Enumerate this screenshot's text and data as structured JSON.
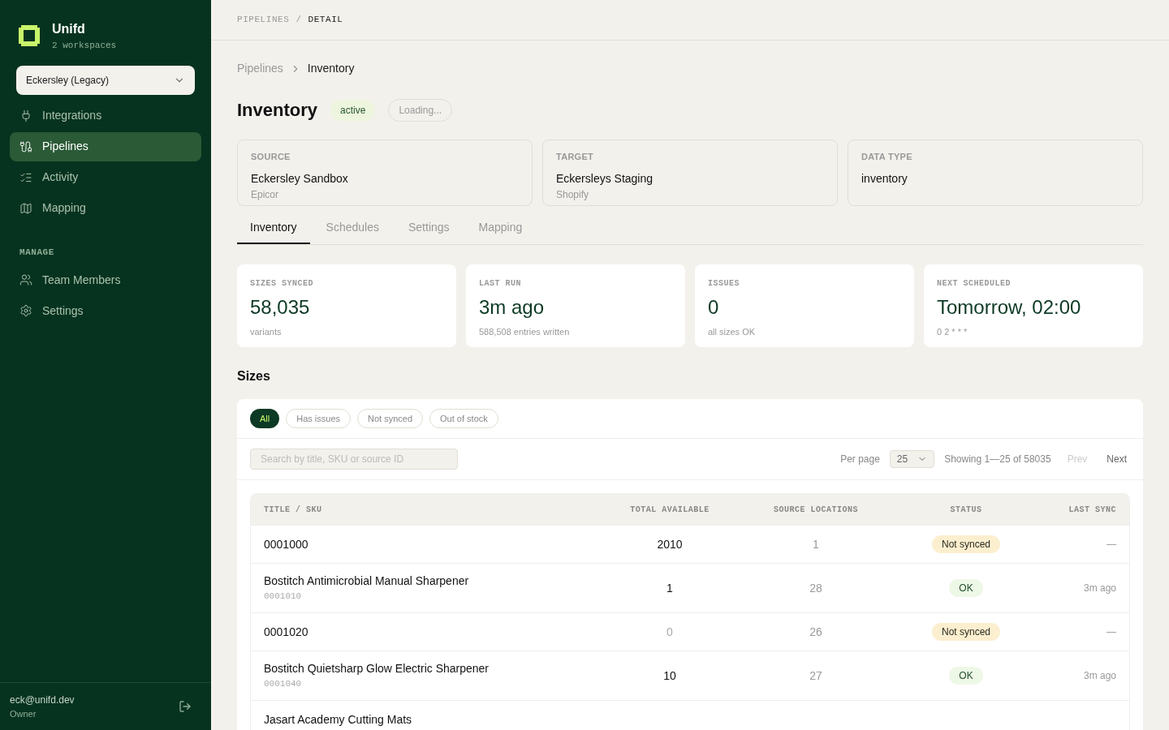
{
  "brand": {
    "name": "Unifd",
    "subtitle": "2 workspaces"
  },
  "workspace": {
    "value": "Eckersley (Legacy)"
  },
  "nav": [
    {
      "label": "Integrations",
      "selected": false
    },
    {
      "label": "Pipelines",
      "selected": true
    },
    {
      "label": "Activity",
      "selected": false
    },
    {
      "label": "Mapping",
      "selected": false
    }
  ],
  "manage": {
    "heading": "MANAGE",
    "items": [
      {
        "label": "Team Members",
        "selected": false
      },
      {
        "label": "Settings",
        "selected": false
      }
    ]
  },
  "user": {
    "email": "eck@unifd.dev",
    "role": "Owner"
  },
  "topbar": {
    "crumbs": [
      "PIPELINES",
      "DETAIL"
    ],
    "separator": "/"
  },
  "breadcrumb": {
    "parent": "Pipelines",
    "current": "Inventory"
  },
  "title": "Inventory",
  "status_badge": "active",
  "loading_badge": "Loading...",
  "info_cards": [
    {
      "label": "SOURCE",
      "value": "Eckersley Sandbox",
      "sub": "Epicor"
    },
    {
      "label": "TARGET",
      "value": "Eckersleys Staging",
      "sub": "Shopify"
    },
    {
      "label": "DATA TYPE",
      "value": "inventory"
    }
  ],
  "tabs": [
    {
      "label": "Inventory",
      "selected": true
    },
    {
      "label": "Schedules",
      "selected": false
    },
    {
      "label": "Settings",
      "selected": false
    },
    {
      "label": "Mapping",
      "selected": false
    }
  ],
  "stats": [
    {
      "label": "SIZES SYNCED",
      "value": "58,035",
      "sub": "variants"
    },
    {
      "label": "LAST RUN",
      "value": "3m ago",
      "sub": "588,508 entries written"
    },
    {
      "label": "ISSUES",
      "value": "0",
      "sub": "all sizes OK"
    },
    {
      "label": "NEXT SCHEDULED",
      "value": "Tomorrow, 02:00",
      "sub": "0 2 * * *"
    }
  ],
  "section_title": "Sizes",
  "filters": [
    {
      "label": "All",
      "selected": true
    },
    {
      "label": "Has issues",
      "selected": false
    },
    {
      "label": "Not synced",
      "selected": false
    },
    {
      "label": "Out of stock",
      "selected": false
    }
  ],
  "search": {
    "placeholder": "Search by title, SKU or source ID"
  },
  "pagination": {
    "per_page_label": "Per page",
    "per_page": "25",
    "showing": "Showing 1—25 of 58035",
    "prev": "Prev",
    "prev_disabled": true,
    "next": "Next"
  },
  "table": {
    "columns": [
      "TITLE / SKU",
      "TOTAL AVAILABLE",
      "SOURCE LOCATIONS",
      "STATUS",
      "LAST SYNC"
    ],
    "rows": [
      {
        "title": "0001000",
        "total": "2010",
        "total_dim": false,
        "locations": "1",
        "status": "Not synced",
        "status_ok": false,
        "last_sync": "—"
      },
      {
        "title": "Bostitch Antimicrobial Manual Sharpener",
        "sku": "0001010",
        "total": "1",
        "total_dim": false,
        "locations": "28",
        "status": "OK",
        "status_ok": true,
        "last_sync": "3m ago"
      },
      {
        "title": "0001020",
        "total": "0",
        "total_dim": true,
        "locations": "26",
        "status": "Not synced",
        "status_ok": false,
        "last_sync": "—"
      },
      {
        "title": "Bostitch Quietsharp Glow Electric Sharpener",
        "sku": "0001040",
        "total": "10",
        "total_dim": false,
        "locations": "27",
        "status": "OK",
        "status_ok": true,
        "last_sync": "3m ago"
      },
      {
        "title": "Jasart Academy Cutting Mats"
      }
    ]
  }
}
